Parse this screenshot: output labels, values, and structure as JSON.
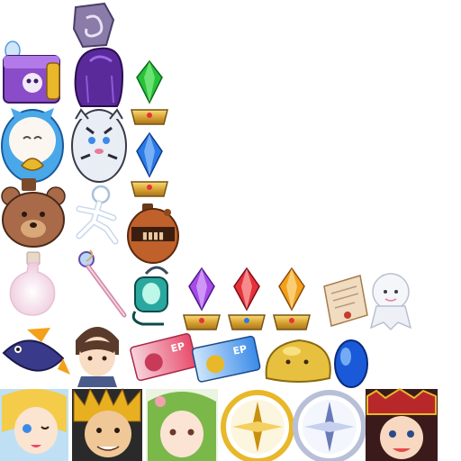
{
  "atlas": {
    "kind": "game item icon sprite sheet",
    "background": "#ffffff"
  },
  "sprites": [
    {
      "id": "sigil-disc",
      "icon": "purple-swirl-sigil-icon",
      "color": "#7a6a9a"
    },
    {
      "id": "purple-chest",
      "icon": "purple-skull-treasure-chest-icon",
      "color": "#8a4cc8"
    },
    {
      "id": "purple-wig",
      "icon": "purple-hair-wig-icon",
      "color": "#5a2a9a"
    },
    {
      "id": "gem-green",
      "icon": "green-crystal-on-gold-stand-icon",
      "color": "#26c23a"
    },
    {
      "id": "lucky-cat",
      "icon": "blue-lucky-cat-icon",
      "color": "#4aa8e8"
    },
    {
      "id": "white-tiger",
      "icon": "white-tiger-pet-icon",
      "color": "#e8eef4"
    },
    {
      "id": "gem-blue",
      "icon": "blue-crystal-on-gold-stand-icon",
      "color": "#2a7ae8"
    },
    {
      "id": "teddy-bear",
      "icon": "brown-teddy-bear-icon",
      "color": "#a86a48"
    },
    {
      "id": "running-figure",
      "icon": "running-stick-figure-icon",
      "color": "#dde8f4"
    },
    {
      "id": "copper-pot",
      "icon": "copper-steampunk-pot-icon",
      "color": "#c0602a"
    },
    {
      "id": "potion",
      "icon": "pink-potion-flask-icon",
      "color": "#f4e0ea"
    },
    {
      "id": "staff",
      "icon": "magic-staff-icon",
      "color": "#d088a8"
    },
    {
      "id": "lantern",
      "icon": "teal-lantern-icon",
      "color": "#2aa8a0"
    },
    {
      "id": "gem-purple",
      "icon": "purple-crystal-on-gold-stand-icon",
      "color": "#a64ae8"
    },
    {
      "id": "gem-red",
      "icon": "red-crystal-on-gold-stand-icon",
      "color": "#e8323a"
    },
    {
      "id": "gem-orange",
      "icon": "orange-crystal-on-gold-stand-icon",
      "color": "#f4a01a"
    },
    {
      "id": "scroll",
      "icon": "parchment-scroll-icon",
      "color": "#f0dcc0"
    },
    {
      "id": "ghost",
      "icon": "white-ghost-doll-icon",
      "color": "#f4f6fa"
    },
    {
      "id": "fish",
      "icon": "blue-fish-icon",
      "color": "#3a3a8a"
    },
    {
      "id": "boy-portrait",
      "icon": "brown-haired-boy-portrait-icon",
      "color": "#5a3a2a"
    },
    {
      "id": "ep-ticket-pink",
      "icon": "pink-ep-ticket-icon",
      "color": "#e84a6a",
      "label": "EP"
    },
    {
      "id": "ep-ticket-blue",
      "icon": "blue-ep-ticket-icon",
      "color": "#3a8ae8",
      "label": "EP"
    },
    {
      "id": "yellow-slime",
      "icon": "yellow-slime-icon",
      "color": "#e8c040"
    },
    {
      "id": "blue-egg",
      "icon": "blue-oval-gem-icon",
      "color": "#1a5ad8"
    },
    {
      "id": "blonde-girl",
      "icon": "blonde-girl-portrait-icon",
      "color": "#f4cc4a"
    },
    {
      "id": "spiky-hero",
      "icon": "spiky-haired-hero-portrait-icon",
      "color": "#e8b020"
    },
    {
      "id": "green-girl",
      "icon": "green-haired-girl-portrait-icon",
      "color": "#7ab84a"
    },
    {
      "id": "gold-compass",
      "icon": "gold-compass-icon",
      "color": "#e8b82a"
    },
    {
      "id": "silver-compass",
      "icon": "silver-compass-icon",
      "color": "#b8c0d8"
    },
    {
      "id": "red-hero",
      "icon": "red-armored-hero-portrait-icon",
      "color": "#b8282a"
    }
  ]
}
